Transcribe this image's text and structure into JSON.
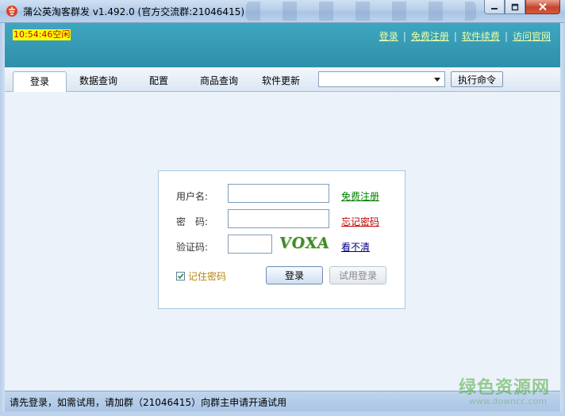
{
  "window": {
    "title": "蒲公英淘客群发 v1.492.0 (官方交流群:21046415)"
  },
  "header": {
    "time": "10:54:46",
    "state": "空闲",
    "links": [
      {
        "label": "登录"
      },
      {
        "label": "免费注册"
      },
      {
        "label": "软件续费"
      },
      {
        "label": "访问官网"
      }
    ],
    "separator": "|"
  },
  "tabs": [
    {
      "label": "登录",
      "active": true
    },
    {
      "label": "数据查询",
      "active": false
    },
    {
      "label": "配置",
      "active": false
    },
    {
      "label": "商品查询",
      "active": false
    },
    {
      "label": "软件更新",
      "active": false
    }
  ],
  "command": {
    "selected": "",
    "execute_label": "执行命令"
  },
  "login": {
    "username_label": "用户名:",
    "username_value": "",
    "password_label": "密　码:",
    "password_value": "",
    "captcha_label": "验证码:",
    "captcha_value": "",
    "captcha_text": "VOXA",
    "register_link": "免费注册",
    "forgot_link": "忘记密码",
    "refresh_captcha_link": "看不清",
    "remember_label": "记住密码",
    "remember_checked": true,
    "login_button": "登录",
    "trial_button": "试用登录"
  },
  "status": {
    "message": "请先登录，如需试用，请加群（21046415）向群主申请开通试用"
  },
  "watermark": {
    "name": "绿色资源网",
    "url": "www.downcc.com"
  },
  "colors": {
    "header_bg": "#2e8fab",
    "link_green": "#008000",
    "link_red": "#c00000",
    "clock_bg": "#ffff00"
  }
}
